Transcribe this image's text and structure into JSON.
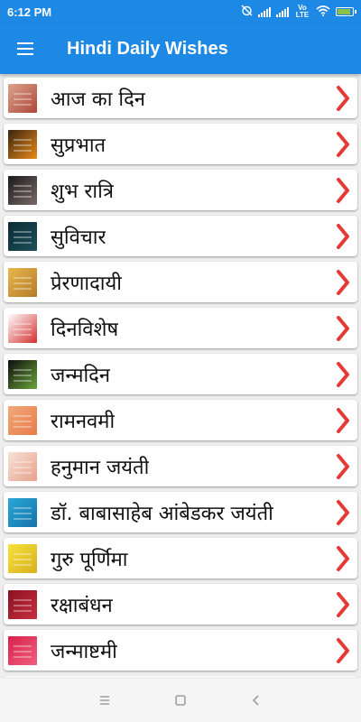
{
  "status_bar": {
    "time": "6:12 PM",
    "network_label": "Vo LTE",
    "icons": [
      "alarm-off-icon",
      "signal-icon",
      "wifi-icon",
      "battery-charging-icon"
    ],
    "battery_level": 0.8
  },
  "app_bar": {
    "title": "Hindi Daily Wishes",
    "menu_icon": "hamburger-menu-icon"
  },
  "colors": {
    "primary": "#1e88e5",
    "chevron": "#e53935",
    "background": "#eeeeee"
  },
  "items": [
    {
      "label": "आज का दिन",
      "thumb_colors": [
        "#d9a48c",
        "#b0463a"
      ]
    },
    {
      "label": "सुप्रभात",
      "thumb_colors": [
        "#3a2410",
        "#e88a1a"
      ]
    },
    {
      "label": "शुभ रात्रि",
      "thumb_colors": [
        "#1a1a1a",
        "#7a6a68"
      ]
    },
    {
      "label": "सुविचार",
      "thumb_colors": [
        "#0d2b34",
        "#1b4f5a"
      ]
    },
    {
      "label": "प्रेरणादायी",
      "thumb_colors": [
        "#e8b84a",
        "#b5792a"
      ]
    },
    {
      "label": "दिनविशेष",
      "thumb_colors": [
        "#ffffff",
        "#d32f2f"
      ]
    },
    {
      "label": "जन्मदिन",
      "thumb_colors": [
        "#0e0e0e",
        "#6aa33a"
      ]
    },
    {
      "label": "रामनवमी",
      "thumb_colors": [
        "#f2a97a",
        "#e87a4a"
      ]
    },
    {
      "label": "हनुमान जयंती",
      "thumb_colors": [
        "#f6e2d8",
        "#e8a08a"
      ]
    },
    {
      "label": "डॉ. बाबासाहेब आंबेडकर जयंती",
      "thumb_colors": [
        "#2aa7d8",
        "#1673a8"
      ]
    },
    {
      "label": "गुरु पूर्णिमा",
      "thumb_colors": [
        "#f6e23a",
        "#d8b020"
      ]
    },
    {
      "label": "रक्षाबंधन",
      "thumb_colors": [
        "#8a1020",
        "#c83040"
      ]
    },
    {
      "label": "जन्माष्टमी",
      "thumb_colors": [
        "#d8204a",
        "#f06080"
      ]
    },
    {
      "label": "",
      "thumb_colors": [
        "#2a2a2a",
        "#555555"
      ]
    }
  ],
  "nav_bar": {
    "buttons": [
      "recents-icon",
      "home-icon",
      "back-icon"
    ]
  }
}
